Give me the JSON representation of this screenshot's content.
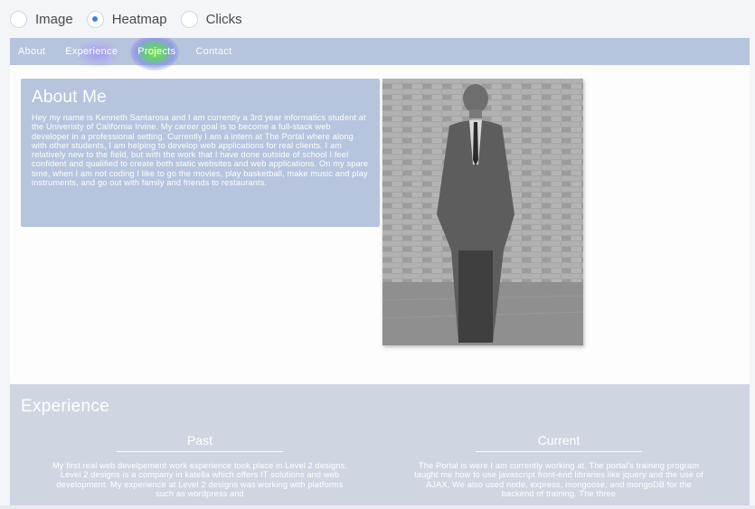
{
  "mode_bar": {
    "options": [
      {
        "label": "Image",
        "selected": false
      },
      {
        "label": "Heatmap",
        "selected": true
      },
      {
        "label": "Clicks",
        "selected": false
      }
    ]
  },
  "site": {
    "nav": [
      "About",
      "Experience",
      "Projects",
      "Contact"
    ],
    "about": {
      "title": "About Me",
      "text": "Hey my name is Kenneth Santarosa and I am currently a 3rd year informatics student at the Univeristy of California Irvine. My career goal is to become a full-stack web developer in a professional setting. Currently I am a intern at The Portal where along with other students, I am helping to develop web applications for real clients. I am relatively new to the field, but with the work that I have done outside of school I feel confident and qualified to create both static websites and web applications. On my spare time, when I am not coding I like to go the movies, play basketball, make music and play instruments, and go out with family and friends to restaurants."
    },
    "experience": {
      "title": "Experience",
      "past": {
        "heading": "Past",
        "text": "My first real web develpement work experience took place in Level 2 designs. Level 2 designs is a company in katella which offers IT solutions and web development. My experience at Level 2 designs was working with platforms such as wordpress and"
      },
      "current": {
        "heading": "Current",
        "text": "The Portal is were I am currently working at. The portal's training program taught me how to use javascript front-end libraries like jquery and the use of AJAX. We also used node, express, mongoose, and mongoDB for the backend of training. The three"
      }
    }
  },
  "colors": {
    "radio_accent": "#3b82e6",
    "nav_bg": "#b7c4dd",
    "card_bg": "#b6c4de",
    "experience_bg": "#cfd6e2",
    "heat_hot": "#78eb3c",
    "heat_cool": "#a096f5"
  }
}
